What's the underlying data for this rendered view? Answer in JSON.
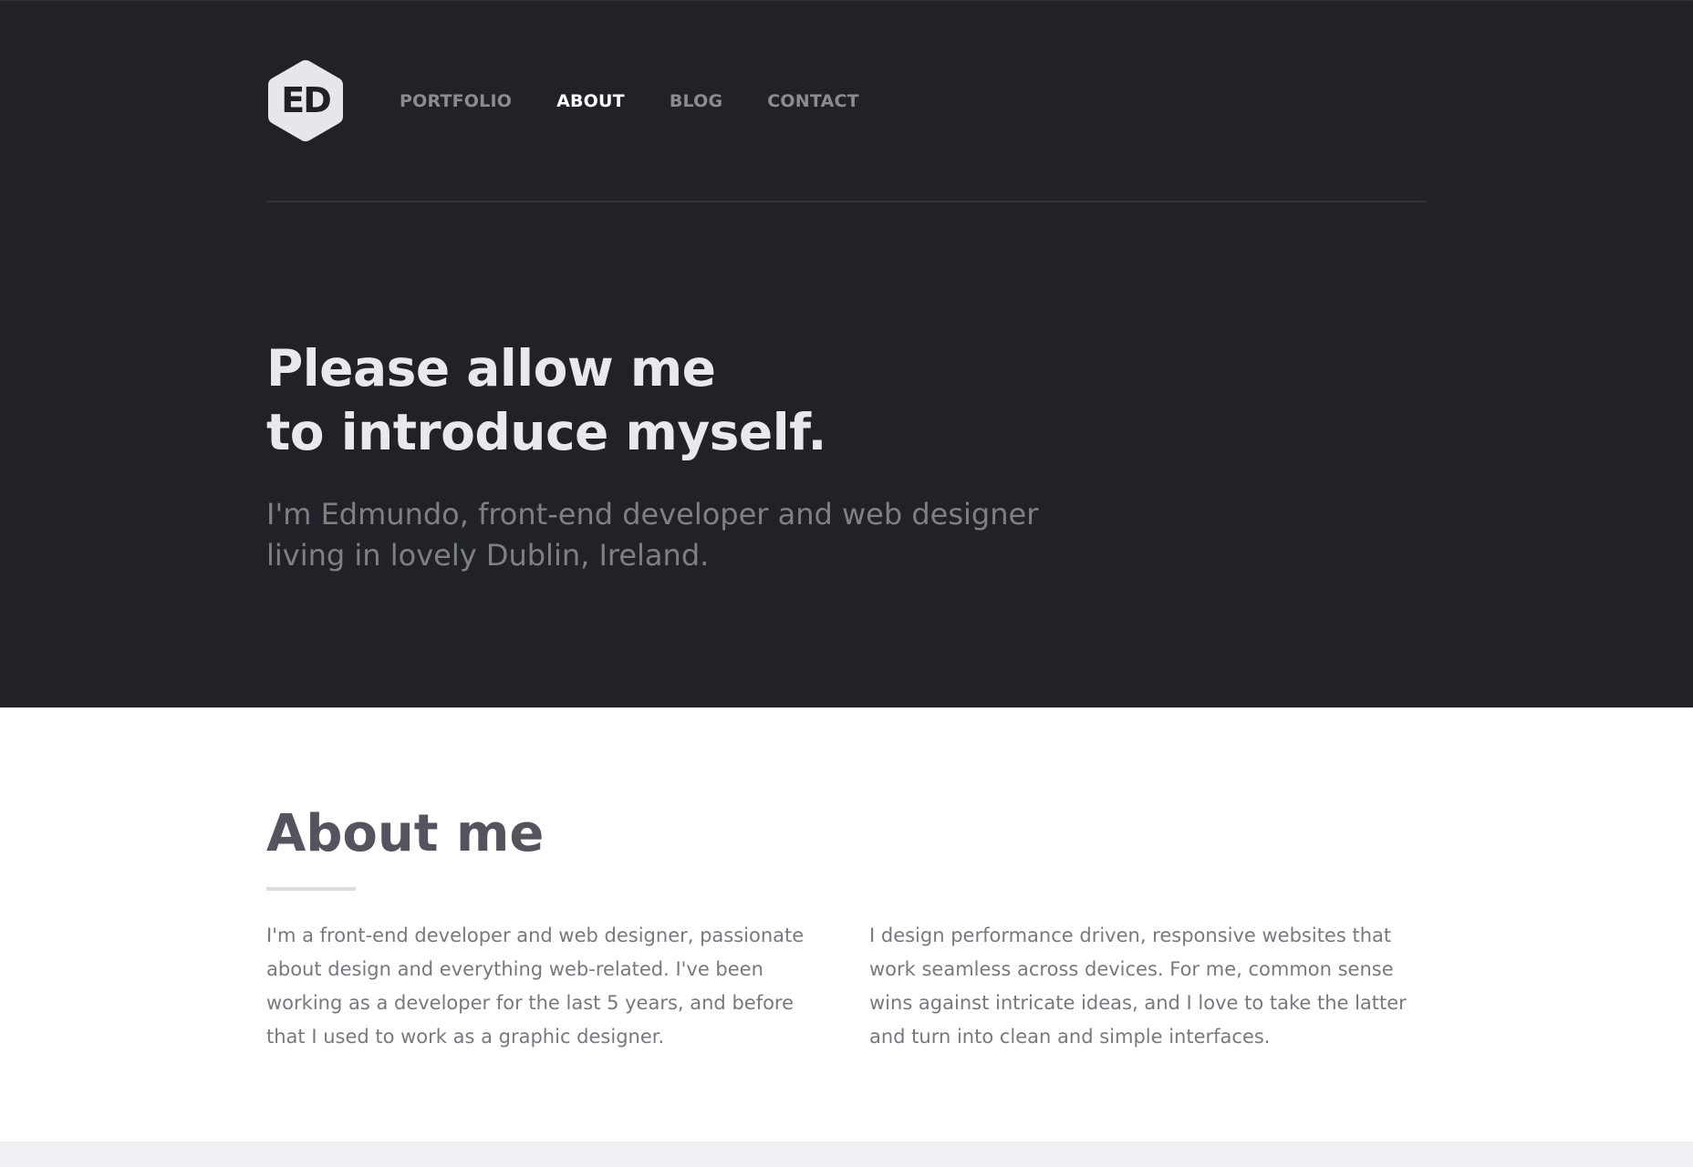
{
  "logo": {
    "text": "ED",
    "colors": {
      "hexagon": "#e6e7ea",
      "text": "#1f2126"
    }
  },
  "nav": {
    "items": [
      {
        "label": "PORTFOLIO",
        "active": false
      },
      {
        "label": "ABOUT",
        "active": true
      },
      {
        "label": "BLOG",
        "active": false
      },
      {
        "label": "CONTACT",
        "active": false
      }
    ]
  },
  "hero": {
    "title_lines": [
      "Please allow me",
      "to introduce myself."
    ],
    "subtitle_lines": [
      "I'm Edmundo, front-end developer and web designer",
      "living in lovely Dublin, Ireland."
    ]
  },
  "about": {
    "title": "About me",
    "left_lines": [
      "I'm a front-end developer and web designer, passionate",
      "about design and everything web-related. I've been",
      "working as a developer for the last 5 years, and before",
      "that I used to work as a graphic designer."
    ],
    "right_lines": [
      "I design performance driven, responsive websites that",
      "work seamless across devices. For me, common sense",
      "wins against intricate ideas, and I love to take the latter",
      "and turn into clean and simple interfaces."
    ]
  },
  "colors": {
    "hero_bg": "#202227",
    "nav_active": "#ffffff",
    "nav_inactive": "#8a8c92",
    "heading_light": "#e8e9ec",
    "heading_dark": "#53545e",
    "body_text": "#777982"
  }
}
